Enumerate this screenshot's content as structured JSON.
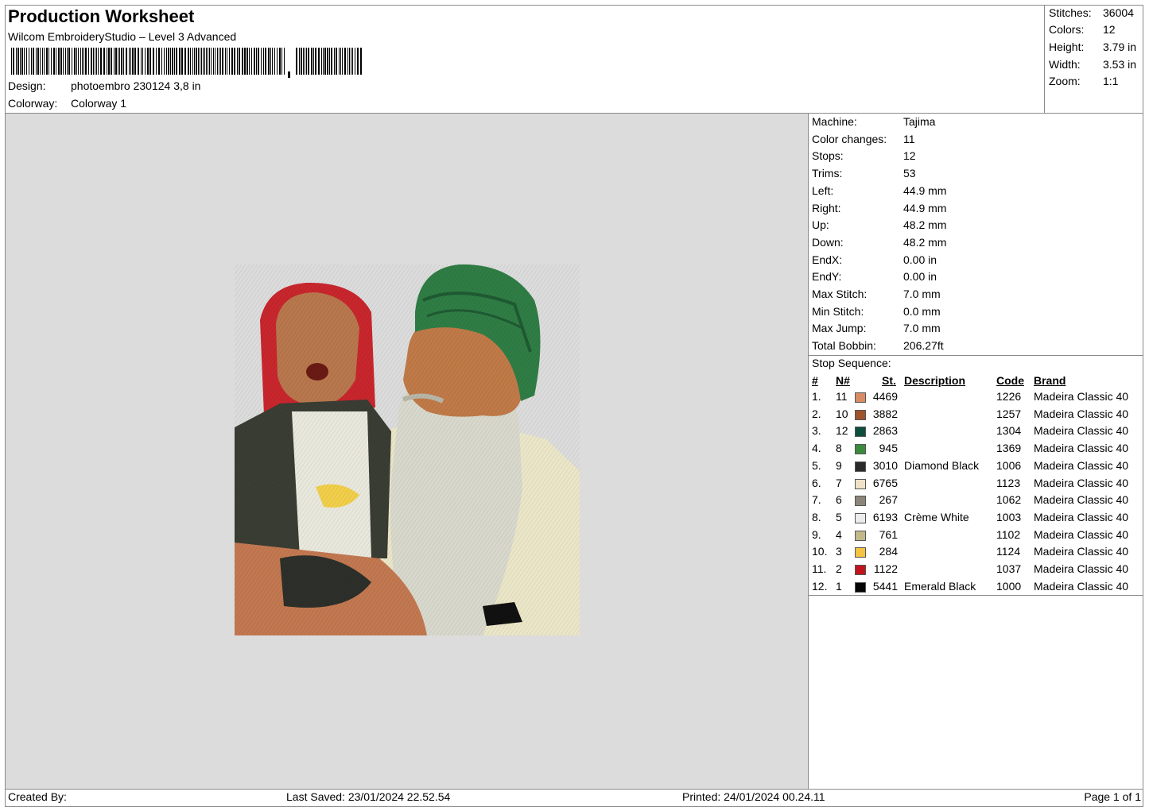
{
  "header": {
    "title": "Production Worksheet",
    "software": "Wilcom EmbroideryStudio – Level 3 Advanced",
    "design_label": "Design:",
    "design_value": "photoembro 230124 3,8 in",
    "colorway_label": "Colorway:",
    "colorway_value": "Colorway 1"
  },
  "stats": [
    {
      "label": "Stitches:",
      "value": "36004"
    },
    {
      "label": "Colors:",
      "value": "12"
    },
    {
      "label": "Height:",
      "value": "3.79 in"
    },
    {
      "label": "Width:",
      "value": "3.53 in"
    },
    {
      "label": "Zoom:",
      "value": "1:1"
    }
  ],
  "machine_info": [
    {
      "label": "Machine:",
      "value": "Tajima"
    },
    {
      "label": "Color changes:",
      "value": "11"
    },
    {
      "label": "Stops:",
      "value": "12"
    },
    {
      "label": "Trims:",
      "value": "53"
    },
    {
      "label": "Left:",
      "value": "44.9 mm"
    },
    {
      "label": "Right:",
      "value": "44.9 mm"
    },
    {
      "label": "Up:",
      "value": "48.2 mm"
    },
    {
      "label": "Down:",
      "value": "48.2 mm"
    },
    {
      "label": "EndX:",
      "value": "0.00 in"
    },
    {
      "label": "EndY:",
      "value": "0.00 in"
    },
    {
      "label": "Max Stitch:",
      "value": "7.0 mm"
    },
    {
      "label": "Min Stitch:",
      "value": "0.0 mm"
    },
    {
      "label": "Max Jump:",
      "value": "7.0 mm"
    },
    {
      "label": "Total Bobbin:",
      "value": "206.27ft"
    }
  ],
  "stop_sequence": {
    "title": "Stop Sequence:",
    "columns": {
      "num": "#",
      "n": "N#",
      "st": "St.",
      "description": "Description",
      "code": "Code",
      "brand": "Brand"
    },
    "rows": [
      {
        "num": "1.",
        "n": "11",
        "color": "#d98c63",
        "st": "4469",
        "description": "",
        "code": "1226",
        "brand": "Madeira Classic 40"
      },
      {
        "num": "2.",
        "n": "10",
        "color": "#a0522d",
        "st": "3882",
        "description": "",
        "code": "1257",
        "brand": "Madeira Classic 40"
      },
      {
        "num": "3.",
        "n": "12",
        "color": "#0d4f3c",
        "st": "2863",
        "description": "",
        "code": "1304",
        "brand": "Madeira Classic 40"
      },
      {
        "num": "4.",
        "n": "8",
        "color": "#3b8a3e",
        "st": "945",
        "description": "",
        "code": "1369",
        "brand": "Madeira Classic 40"
      },
      {
        "num": "5.",
        "n": "9",
        "color": "#2a2a2a",
        "st": "3010",
        "description": "Diamond Black",
        "code": "1006",
        "brand": "Madeira Classic 40"
      },
      {
        "num": "6.",
        "n": "7",
        "color": "#efe2c8",
        "st": "6765",
        "description": "",
        "code": "1123",
        "brand": "Madeira Classic 40"
      },
      {
        "num": "7.",
        "n": "6",
        "color": "#8c857a",
        "st": "267",
        "description": "",
        "code": "1062",
        "brand": "Madeira Classic 40"
      },
      {
        "num": "8.",
        "n": "5",
        "color": "#ececec",
        "st": "6193",
        "description": "Crème White",
        "code": "1003",
        "brand": "Madeira Classic 40"
      },
      {
        "num": "9.",
        "n": "4",
        "color": "#c2b88a",
        "st": "761",
        "description": "",
        "code": "1102",
        "brand": "Madeira Classic 40"
      },
      {
        "num": "10.",
        "n": "3",
        "color": "#f5c242",
        "st": "284",
        "description": "",
        "code": "1124",
        "brand": "Madeira Classic 40"
      },
      {
        "num": "11.",
        "n": "2",
        "color": "#c0141c",
        "st": "1122",
        "description": "",
        "code": "1037",
        "brand": "Madeira Classic 40"
      },
      {
        "num": "12.",
        "n": "1",
        "color": "#050505",
        "st": "5441",
        "description": "Emerald Black",
        "code": "1000",
        "brand": "Madeira Classic 40"
      }
    ]
  },
  "footer": {
    "created_by": "Created By:",
    "last_saved": "Last Saved: 23/01/2024 22.52.54",
    "printed": "Printed: 24/01/2024 00.24.11",
    "page": "Page 1 of 1"
  }
}
